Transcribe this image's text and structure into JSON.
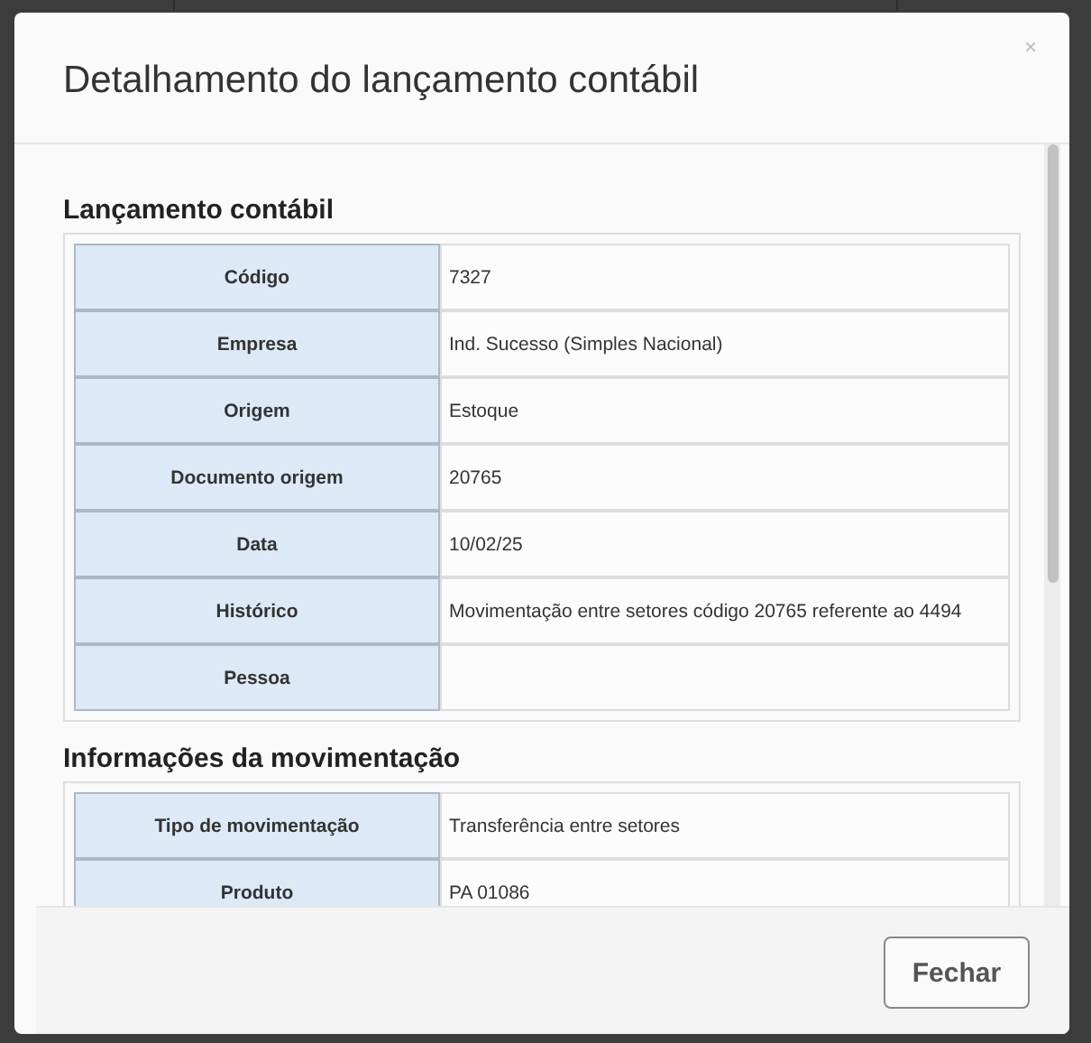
{
  "modal": {
    "title": "Detalhamento do lançamento contábil",
    "close": "×",
    "sections": [
      {
        "title": "Lançamento contábil",
        "rows": [
          {
            "label": "Código",
            "value": "7327"
          },
          {
            "label": "Empresa",
            "value": "Ind. Sucesso (Simples Nacional)"
          },
          {
            "label": "Origem",
            "value": "Estoque"
          },
          {
            "label": "Documento origem",
            "value": "20765"
          },
          {
            "label": "Data",
            "value": "10/02/25"
          },
          {
            "label": "Histórico",
            "value": "Movimentação entre setores código 20765 referente ao 4494"
          },
          {
            "label": "Pessoa"
          }
        ]
      },
      {
        "title": "Informações da movimentação",
        "rows": [
          {
            "label": "Tipo de movimentação",
            "value": "Transferência entre setores"
          },
          {
            "label": "Produto",
            "value": "PA 01086"
          }
        ]
      }
    ],
    "footer": {
      "button": "Fechar"
    }
  }
}
